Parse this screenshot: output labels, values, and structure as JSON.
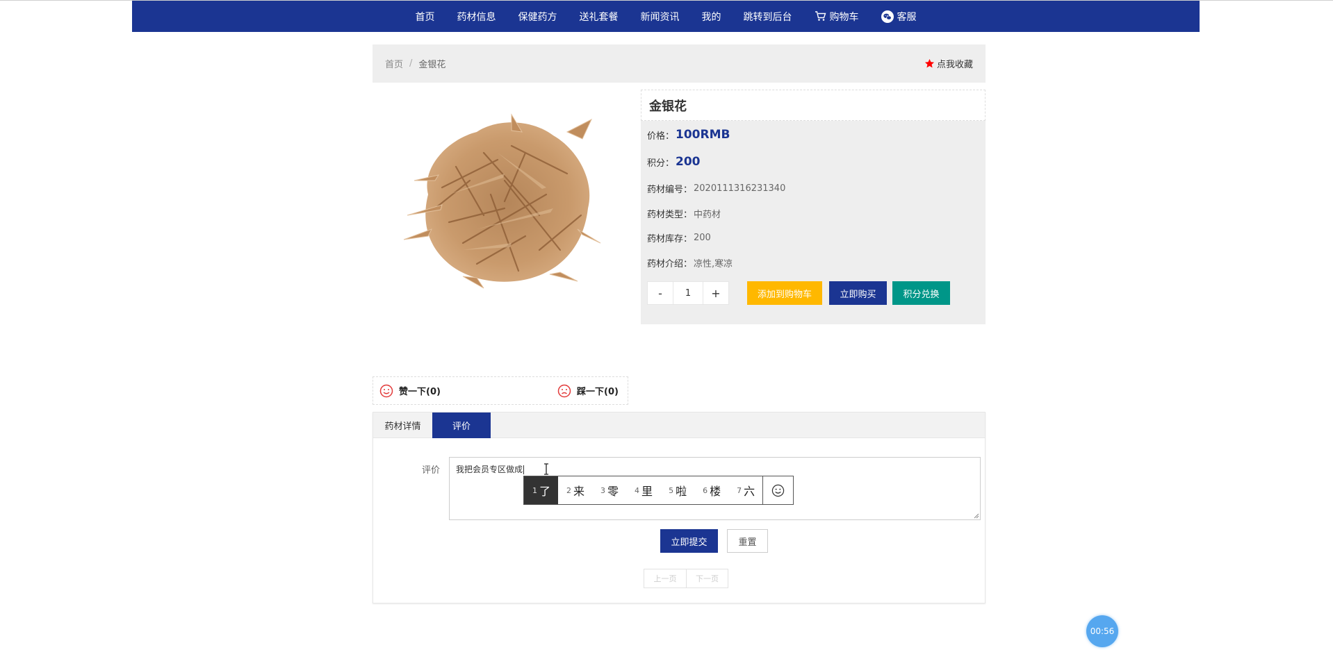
{
  "nav": {
    "items": [
      "首页",
      "药材信息",
      "保健药方",
      "送礼套餐",
      "新闻资讯",
      "我的",
      "跳转到后台"
    ],
    "cart_label": "购物车",
    "service_label": "客服"
  },
  "breadcrumb": {
    "home": "首页",
    "separator": "/",
    "current": "金银花",
    "favorite_label": "点我收藏"
  },
  "product": {
    "name": "金银花",
    "price_label": "价格：",
    "price": "100RMB",
    "points_label": "积分：",
    "points": "200",
    "code_label": "药材编号：",
    "code": "2020111316231340",
    "type_label": "药材类型：",
    "type": "中药材",
    "stock_label": "药材库存：",
    "stock": "200",
    "intro_label": "药材介绍：",
    "intro": "凉性,寒凉"
  },
  "quantity": {
    "minus": "-",
    "value": "1",
    "plus": "+"
  },
  "actions": {
    "add_to_cart": "添加到购物车",
    "buy_now": "立即购买",
    "points_exchange": "积分兑换"
  },
  "votes": {
    "like_label": "赞一下(0)",
    "dislike_label": "踩一下(0)"
  },
  "tabs": {
    "details": "药材详情",
    "review": "评价"
  },
  "review_form": {
    "label": "评价",
    "text": "我把会员专区做成",
    "submit": "立即提交",
    "reset": "重置"
  },
  "ime": {
    "candidates": [
      {
        "num": "1",
        "char": "了"
      },
      {
        "num": "2",
        "char": "来"
      },
      {
        "num": "3",
        "char": "零"
      },
      {
        "num": "4",
        "char": "里"
      },
      {
        "num": "5",
        "char": "啦"
      },
      {
        "num": "6",
        "char": "楼"
      },
      {
        "num": "7",
        "char": "六"
      }
    ],
    "selected_index": 0
  },
  "pagination": {
    "prev": "上一页",
    "next": "下一页"
  },
  "timer": {
    "text": "00:56"
  },
  "colors": {
    "primary": "#1b3592",
    "warning": "#ffb800",
    "teal": "#009688",
    "star": "#ff0000",
    "face": "#e23a3a"
  }
}
